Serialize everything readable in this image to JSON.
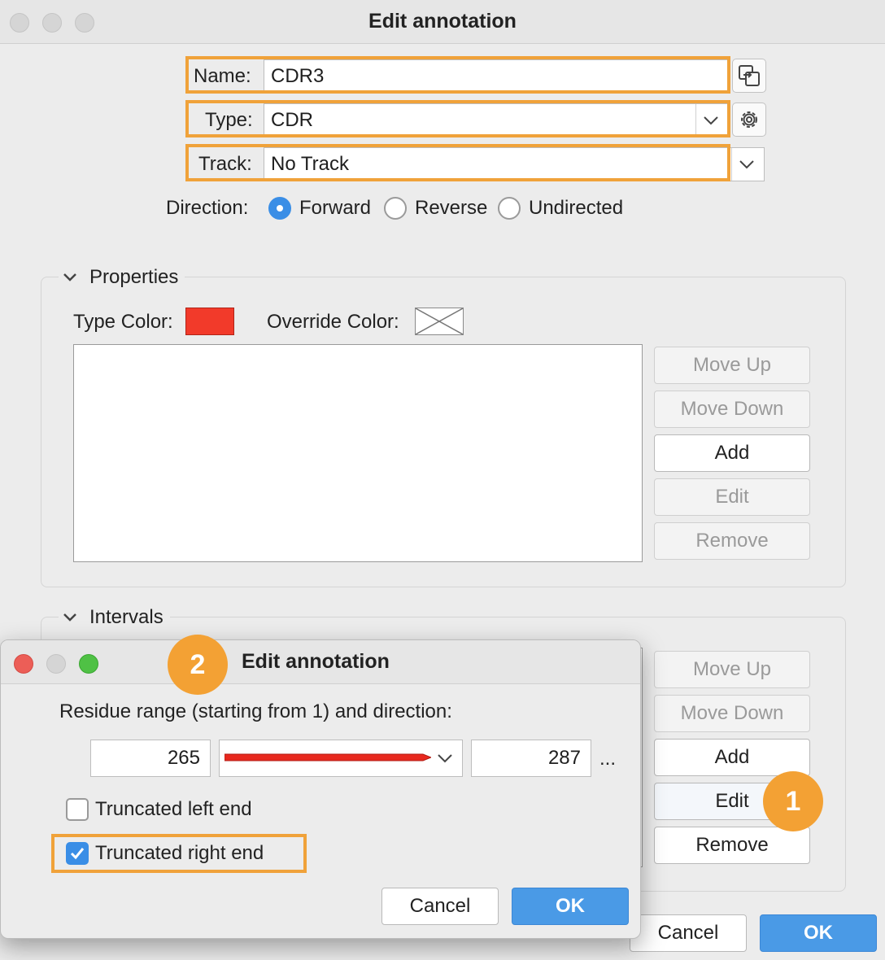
{
  "main": {
    "title": "Edit annotation",
    "name_label": "Name:",
    "name_value": "CDR3",
    "type_label": "Type:",
    "type_value": "CDR",
    "track_label": "Track:",
    "track_value": "No Track",
    "direction_label": "Direction:",
    "directions": [
      "Forward",
      "Reverse",
      "Undirected"
    ],
    "selected_direction": "Forward",
    "properties": {
      "title": "Properties",
      "type_color_label": "Type Color:",
      "type_color": "#f23a2a",
      "override_color_label": "Override Color:",
      "buttons": [
        "Move Up",
        "Move Down",
        "Add",
        "Edit",
        "Remove"
      ]
    },
    "intervals": {
      "title": "Intervals",
      "buttons": [
        "Move Up",
        "Move Down",
        "Add",
        "Edit",
        "Remove"
      ]
    },
    "cancel_label": "Cancel",
    "ok_label": "OK"
  },
  "sub": {
    "title": "Edit annotation",
    "range_label": "Residue range (starting from 1) and direction:",
    "start": "265",
    "end": "287",
    "more": "...",
    "truncated_left_label": "Truncated left end",
    "truncated_left": false,
    "truncated_right_label": "Truncated right end",
    "truncated_right": true,
    "cancel_label": "Cancel",
    "ok_label": "OK"
  },
  "callouts": [
    "1",
    "2"
  ],
  "colors": {
    "highlight": "#f0a23a",
    "accent": "#4a9ae6",
    "arrow": "#e8281e"
  }
}
